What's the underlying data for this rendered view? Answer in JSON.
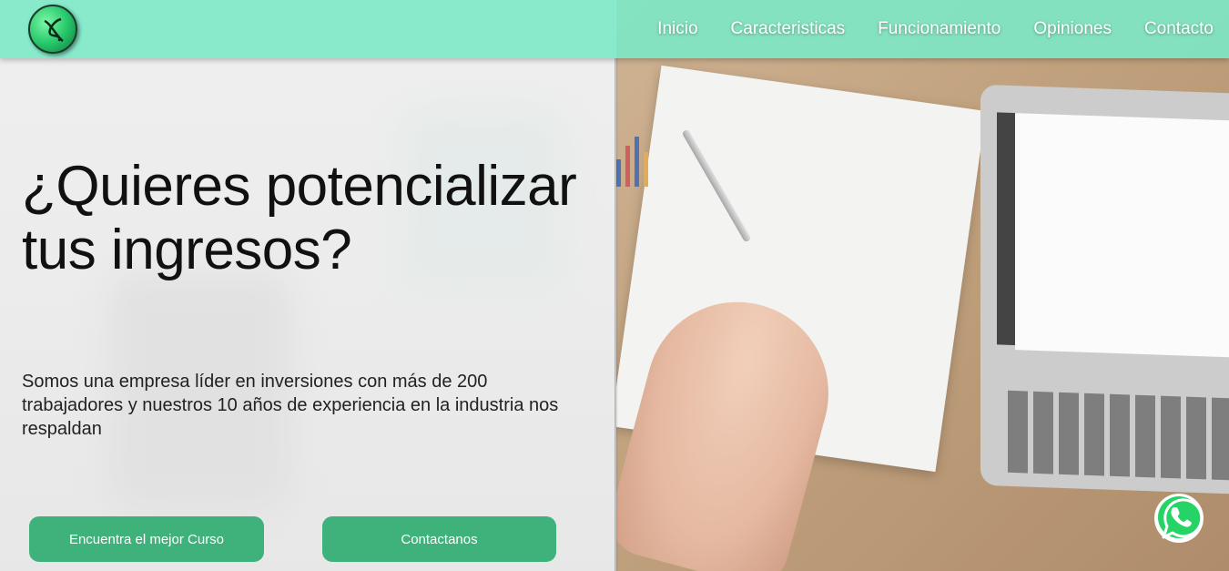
{
  "nav": {
    "items": [
      "Inicio",
      "Caracteristicas",
      "Funcionamiento",
      "Opiniones",
      "Contacto"
    ]
  },
  "hero": {
    "title_line1": "¿Quieres potencializar",
    "title_line2": "tus ingresos?",
    "description": "Somos una empresa líder en inversiones con más de 200 trabajadores y nuestros 10 años de experiencia en la industria nos respaldan",
    "button_course": "Encuentra el mejor Curso",
    "button_contact": "Contactanos"
  },
  "colors": {
    "navbar": "#7ce8c7",
    "button": "#3fb27c",
    "whatsapp": "#25d366"
  },
  "icons": {
    "logo": "brand-logo-icon",
    "whatsapp": "whatsapp-icon"
  }
}
